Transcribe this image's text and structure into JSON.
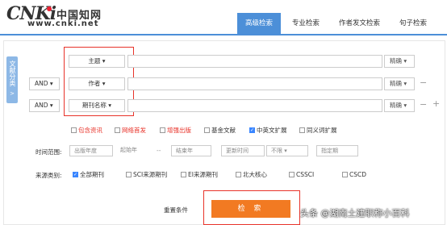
{
  "header": {
    "logo_mark": "CNKi",
    "logo_cn": "中国知网",
    "logo_url": "www.cnki.net",
    "tabs": [
      "高级检索",
      "专业检索",
      "作者发文检索",
      "句子检索"
    ]
  },
  "side_tab": {
    "label": "文献分类",
    "arrow": ">"
  },
  "rows": [
    {
      "logic": "",
      "field": "主题 ▾",
      "exact": "精确 ▾"
    },
    {
      "logic": "AND ▾",
      "field": "作者 ▾",
      "exact": "精确 ▾"
    },
    {
      "logic": "AND ▾",
      "field": "期刊名称 ▾",
      "exact": "精确 ▾"
    }
  ],
  "plus_minus": {
    "minus": "−",
    "plus": "+"
  },
  "options": [
    {
      "label": "包含资讯",
      "checked": false,
      "red": true
    },
    {
      "label": "网络首发",
      "checked": false,
      "red": true
    },
    {
      "label": "增强出版",
      "checked": false,
      "red": true
    },
    {
      "label": "基金文献",
      "checked": false,
      "red": false
    },
    {
      "label": "中英文扩展",
      "checked": true,
      "red": false
    },
    {
      "label": "同义词扩展",
      "checked": false,
      "red": false
    }
  ],
  "time": {
    "label": "时间范围:",
    "pub_year": "出版年度",
    "start": "起始年",
    "dash": "--",
    "end": "结束年",
    "update_label": "更新时间",
    "update_value": "不限 ▾",
    "period": "指定期"
  },
  "source": {
    "label": "来源类别:",
    "items": [
      {
        "label": "全部期刊",
        "checked": true
      },
      {
        "label": "SCI来源期刊",
        "checked": false
      },
      {
        "label": "EI来源期刊",
        "checked": false
      },
      {
        "label": "北大核心",
        "checked": false
      },
      {
        "label": "CSSCI",
        "checked": false
      },
      {
        "label": "CSCD",
        "checked": false
      }
    ]
  },
  "actions": {
    "reset": "重置条件",
    "search": "检 索"
  },
  "watermark": "头条 @湖南土建职称小百科",
  "colors": {
    "accent": "#4c8fd8",
    "search": "#f27a22",
    "highlight": "#e8332a"
  }
}
